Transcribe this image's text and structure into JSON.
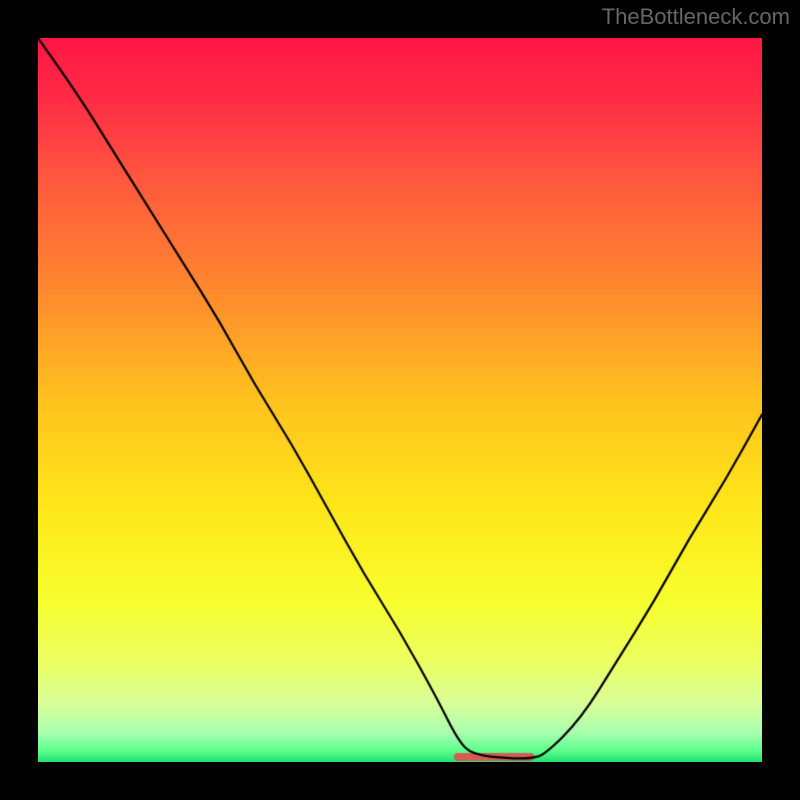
{
  "watermark": "TheBottleneck.com",
  "chart_data": {
    "type": "line",
    "title": "",
    "xlabel": "",
    "ylabel": "",
    "xlim": [
      0,
      100
    ],
    "ylim": [
      0,
      100
    ],
    "series": [
      {
        "name": "curve",
        "x": [
          0,
          5,
          10,
          15,
          20,
          25,
          30,
          35,
          40,
          45,
          50,
          55,
          58,
          60,
          65,
          68,
          70,
          75,
          80,
          85,
          90,
          95,
          100
        ],
        "values": [
          100,
          93,
          85,
          77,
          69,
          61,
          52,
          44,
          35,
          26,
          18,
          9,
          3,
          1,
          0.5,
          0.5,
          1,
          6,
          14,
          22,
          31,
          39,
          48
        ]
      }
    ],
    "flat_segment": {
      "x0": 58,
      "x1": 68,
      "y": 0.7,
      "color": "#d65a55",
      "thickness": 8
    },
    "gradient_stops": [
      {
        "pos": 0.0,
        "color": "#ff1744"
      },
      {
        "pos": 0.08,
        "color": "#ff2a46"
      },
      {
        "pos": 0.2,
        "color": "#ff5a3e"
      },
      {
        "pos": 0.35,
        "color": "#ff8a2e"
      },
      {
        "pos": 0.5,
        "color": "#ffc21e"
      },
      {
        "pos": 0.65,
        "color": "#ffe81a"
      },
      {
        "pos": 0.78,
        "color": "#f7ff2e"
      },
      {
        "pos": 0.86,
        "color": "#ecff62"
      },
      {
        "pos": 0.92,
        "color": "#d8ff9a"
      },
      {
        "pos": 0.96,
        "color": "#a8ffb0"
      },
      {
        "pos": 0.985,
        "color": "#5cff8c"
      },
      {
        "pos": 1.0,
        "color": "#20e070"
      }
    ],
    "curve_color": "#000000",
    "curve_width": 2.2
  }
}
